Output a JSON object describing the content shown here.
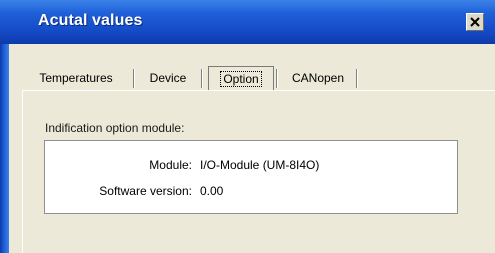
{
  "window": {
    "title": "Acutal values",
    "close_symbol": "×"
  },
  "tabs": [
    {
      "label": "Temperatures",
      "selected": false
    },
    {
      "label": "Device",
      "selected": false
    },
    {
      "label": "Option",
      "selected": true
    },
    {
      "label": "CANopen",
      "selected": false
    }
  ],
  "option_panel": {
    "group_label": "Indification option module:",
    "rows": [
      {
        "key": "Module:",
        "value": "I/O-Module (UM-8I4O)"
      },
      {
        "key": "Software version:",
        "value": "0.00"
      }
    ]
  },
  "colors": {
    "titlebar": "#1f5fd8",
    "dialog_face": "#ece9d8"
  }
}
